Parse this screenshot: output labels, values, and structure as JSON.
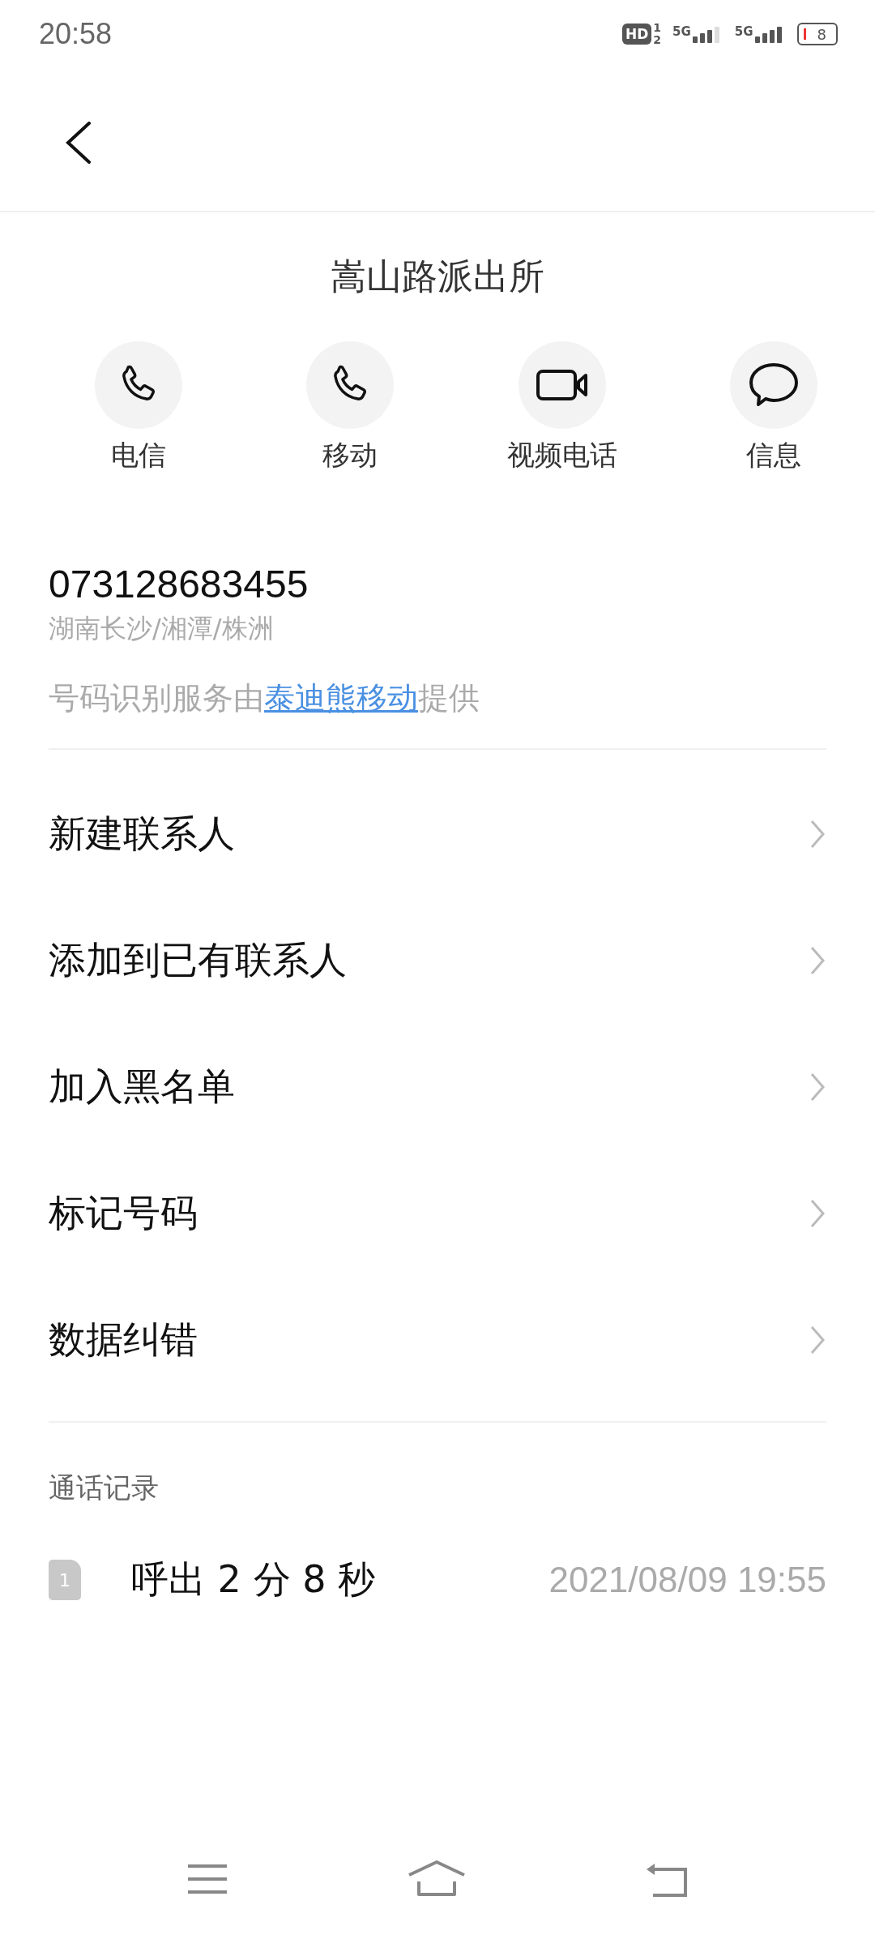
{
  "status_bar": {
    "time": "20:58",
    "hd": "HD",
    "hd_sims": [
      "1",
      "2"
    ],
    "networks": [
      "5G",
      "5G"
    ],
    "battery": "8"
  },
  "contact": {
    "name": "嵩山路派出所"
  },
  "actions": [
    {
      "kind": "phone",
      "label": "电信"
    },
    {
      "kind": "phone",
      "label": "移动"
    },
    {
      "kind": "video",
      "label": "视频电话"
    },
    {
      "kind": "message",
      "label": "信息"
    }
  ],
  "number": {
    "value": "073128683455",
    "location": "湖南长沙/湘潭/株洲",
    "provider_prefix": "号码识别服务由",
    "provider_link": "泰迪熊移动",
    "provider_suffix": "提供"
  },
  "menu": [
    "新建联系人",
    "添加到已有联系人",
    "加入黑名单",
    "标记号码",
    "数据纠错"
  ],
  "call_log": {
    "title": "通话记录",
    "rows": [
      {
        "sim": "1",
        "summary": "呼出 2 分 8 秒",
        "time": "2021/08/09 19:55"
      }
    ]
  }
}
